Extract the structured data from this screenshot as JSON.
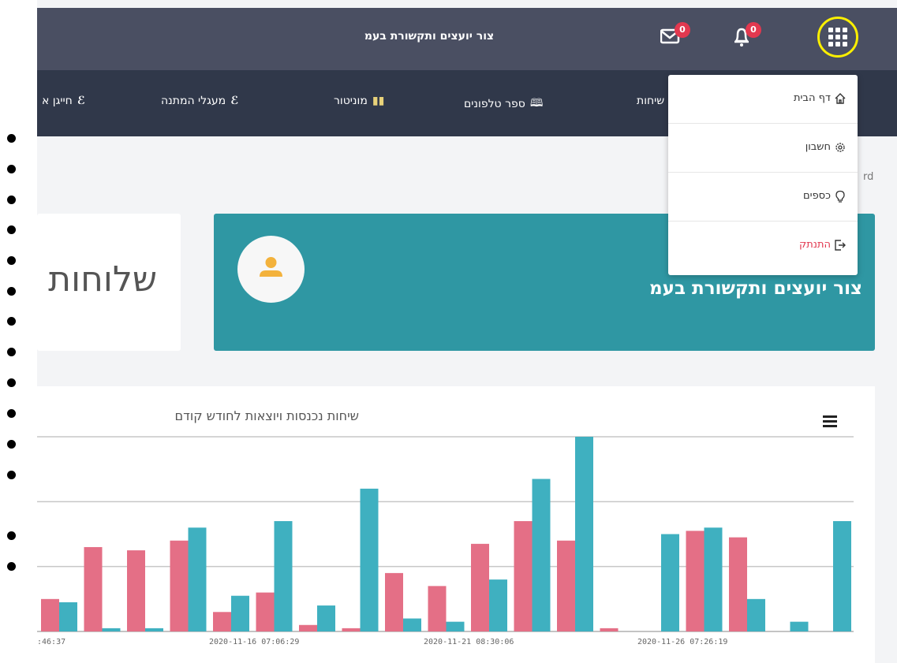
{
  "header": {
    "app_title": "צור יועצים ותקשורת בעמ",
    "mail_badge": "0",
    "bell_badge": "0"
  },
  "nav": {
    "items": [
      {
        "label": "שיחות",
        "icon": "phone-icon"
      },
      {
        "label": "ספר טלפונים",
        "icon": "book-icon"
      },
      {
        "label": "מוניטור",
        "icon": "bar-chart-icon"
      },
      {
        "label": "מעגלי המתנה",
        "icon": "link-icon"
      },
      {
        "label": "חייגן א",
        "icon": "link-icon"
      }
    ]
  },
  "breadcrumb": "rd",
  "dropdown": {
    "items": [
      {
        "label": "דף הבית",
        "icon": "home-icon"
      },
      {
        "label": "חשבון",
        "icon": "gear-icon"
      },
      {
        "label": "כספים",
        "icon": "lightbulb-icon"
      },
      {
        "label": "התנתק",
        "icon": "logout-icon"
      }
    ]
  },
  "user_card": {
    "name": "צור יועצים ותקשורת בעמ"
  },
  "side_card": {
    "title": "שלוחות"
  },
  "chart_section": {
    "title": "שיחות נכנסות ויוצאות לחודש קודם"
  },
  "colors": {
    "topbar": "#4a4f62",
    "navbar": "#30384a",
    "teal": "#2f97a3",
    "series_pink": "#e46f86",
    "series_teal": "#3fb0c0",
    "badge": "#e2384f",
    "highlight_ring": "#fbef00"
  },
  "chart_data": {
    "type": "bar",
    "categories": [
      "",
      "",
      "",
      "",
      "",
      "",
      "",
      "",
      "",
      "",
      "",
      "",
      "",
      "",
      "",
      "",
      "",
      "",
      "",
      ""
    ],
    "x_tick_labels": [
      ":46:37",
      "2020-11-16 07:06:29",
      "2020-11-21 08:30:06",
      "2020-11-26 07:26:19"
    ],
    "series": [
      {
        "values": [
          5,
          13,
          12.5,
          14,
          3,
          6,
          1,
          0.5,
          9,
          7,
          13.5,
          17,
          14,
          0.5,
          0,
          15.5,
          14.5,
          0,
          0,
          0
        ]
      },
      {
        "values": [
          4.5,
          0.5,
          0.5,
          16,
          5.5,
          17,
          4,
          22,
          2,
          1.5,
          8,
          23.5,
          30,
          0,
          15,
          16,
          5,
          1.5,
          17,
          15
        ]
      }
    ],
    "ylim": [
      0,
      30
    ],
    "grid": true
  }
}
